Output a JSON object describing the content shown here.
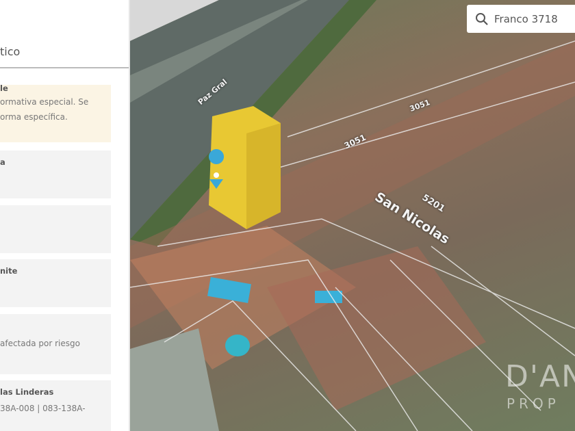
{
  "panel": {
    "tab_label": "tico",
    "cards": [
      {
        "title": "le",
        "lines": [
          "ormativa especial. Se",
          "orma específica."
        ],
        "warn": true
      },
      {
        "title": "a",
        "lines": []
      },
      {
        "title": "",
        "lines": []
      },
      {
        "title": "nite",
        "lines": []
      },
      {
        "title": "",
        "lines": [
          "afectada por riesgo"
        ]
      },
      {
        "title": "las Linderas",
        "lines": [
          "38A-008 | 083-138A-"
        ]
      }
    ]
  },
  "search": {
    "value": "Franco 3718",
    "icon": "search-icon"
  },
  "map": {
    "street_labels": [
      "San Nicolas",
      "5201",
      "3051",
      "3051",
      "Paz Gral"
    ],
    "watermark": [
      "D'AN",
      "PROP"
    ],
    "marker_color": "#3aa8d8",
    "building_color": "#e8c833"
  }
}
